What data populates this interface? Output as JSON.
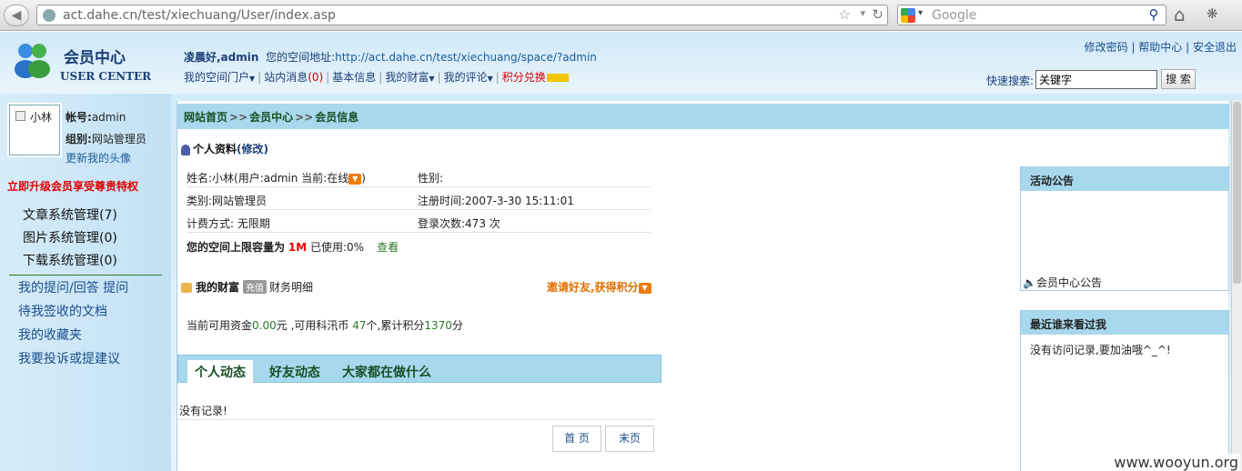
{
  "browser": {
    "url": "act.dahe.cn/test/xiechuang/User/index.asp",
    "search_placeholder": "Google"
  },
  "header": {
    "logo_cn": "会员中心",
    "logo_en": "USER CENTER",
    "greeting": "凌晨好,admin",
    "space_label": "您的空间地址:",
    "space_url": "http://act.dahe.cn/test/xiechuang/space/?admin",
    "top_links": [
      "修改密码",
      "帮助中心",
      "安全退出"
    ],
    "nav": [
      {
        "label": "我的空间门户",
        "dropdown": true
      },
      {
        "label": "站内消息",
        "count": "(0)"
      },
      {
        "label": "基本信息"
      },
      {
        "label": "我的财富",
        "dropdown": true
      },
      {
        "label": "我的评论",
        "dropdown": true
      },
      {
        "label": "积分兑换"
      }
    ],
    "quick_search_label": "快速搜索:",
    "quick_search_value": "关键字",
    "search_button": "搜 索"
  },
  "sidebar": {
    "avatar_name": "小林",
    "account_label": "帐号:",
    "account_value": "admin",
    "group_label": "组别:",
    "group_value": "网站管理员",
    "update_avatar": "更新我的头像",
    "upgrade": "立即升级会员享受尊贵特权",
    "mgmt": [
      "文章系统管理(7)",
      "图片系统管理(0)",
      "下载系统管理(0)"
    ],
    "links": [
      "我的提问/回答 提问",
      "待我签收的文档",
      "我的收藏夹",
      "我要投诉或提建议"
    ]
  },
  "breadcrumb": {
    "items": [
      "网站首页",
      "会员中心",
      "会员信息"
    ],
    "separator": ">>"
  },
  "profile": {
    "title": "个人资料",
    "edit": "(修改)",
    "name": "姓名:小林(用户:admin 当前:在线",
    "name_end": ")",
    "gender": "性别:",
    "type": "类别:网站管理员",
    "register_time": "注册时间:2007-3-30 15:11:01",
    "billing": "计费方式: 无限期",
    "login_count": "登录次数:473 次",
    "quota_prefix": "您的空间上限容量为",
    "quota_value": "1M",
    "quota_used": "已使用:0%",
    "view": "查看"
  },
  "wealth": {
    "title": "我的财富",
    "tag": "充值",
    "detail": "财务明细",
    "invite": "邀请好友,获得积分",
    "funds_prefix": "当前可用资金",
    "funds_value": "0.00",
    "funds_unit": "元",
    "coins_prefix": ",可用科汛币",
    "coins_value": "47",
    "coins_unit": "个,累计积分",
    "points_value": "1370",
    "points_unit": "分"
  },
  "tabs": [
    "个人动态",
    "好友动态",
    "大家都在做什么"
  ],
  "feed": {
    "empty": "没有记录!",
    "first_page": "首 页",
    "last_page": "末页"
  },
  "panels": {
    "notice_title": "活动公告",
    "notice_item": "会员中心公告",
    "visitors_title": "最近谁来看过我",
    "visitors_empty": "没有访问记录,要加油哦^_^!"
  },
  "watermark": "www.wooyun.org",
  "colors": {
    "accent_blue": "#a8d8ee",
    "link_dark": "#1c3f77",
    "alert_red": "#e00000",
    "green": "#2d7a2d",
    "orange": "#e07000"
  }
}
